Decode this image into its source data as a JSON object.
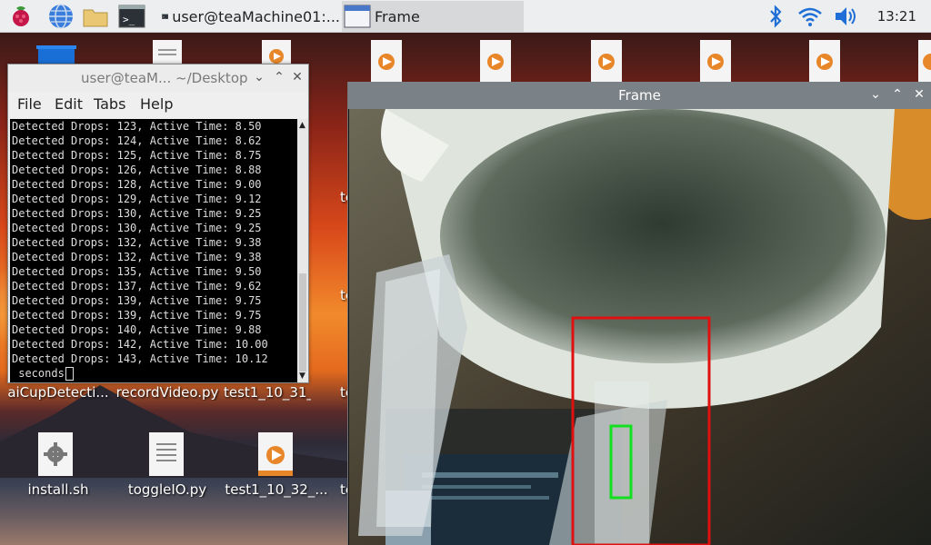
{
  "taskbar": {
    "tasks": [
      {
        "label": "user@teaMachine01:..."
      },
      {
        "label": "Frame"
      }
    ],
    "clock": "13:21"
  },
  "desktop": {
    "icons": [
      {
        "label": "aiCupDetecti..."
      },
      {
        "label": "recordVideo.py"
      },
      {
        "label": "test1_10_31_..."
      },
      {
        "label": "install.sh"
      },
      {
        "label": "toggleIO.py"
      },
      {
        "label": "test1_10_32_..."
      }
    ],
    "partial_labels": [
      "te",
      "te",
      "te",
      "te",
      "te",
      "te"
    ]
  },
  "terminal": {
    "title": "user@teaM... ~/Desktop",
    "menu": [
      "File",
      "Edit",
      "Tabs",
      "Help"
    ],
    "lines": [
      "Detected Drops: 123, Active Time: 8.50",
      "Detected Drops: 124, Active Time: 8.62",
      "Detected Drops: 125, Active Time: 8.75",
      "Detected Drops: 126, Active Time: 8.88",
      "Detected Drops: 128, Active Time: 9.00",
      "Detected Drops: 129, Active Time: 9.12",
      "Detected Drops: 130, Active Time: 9.25",
      "Detected Drops: 130, Active Time: 9.25",
      "Detected Drops: 132, Active Time: 9.38",
      "Detected Drops: 132, Active Time: 9.38",
      "Detected Drops: 135, Active Time: 9.50",
      "Detected Drops: 137, Active Time: 9.62",
      "Detected Drops: 139, Active Time: 9.75",
      "Detected Drops: 139, Active Time: 9.75",
      "Detected Drops: 140, Active Time: 9.88",
      "Detected Drops: 142, Active Time: 10.00",
      "Detected Drops: 143, Active Time: 10.12",
      " seconds"
    ]
  },
  "frame_window": {
    "title": "Frame"
  },
  "colors": {
    "detection_box": "#e01010",
    "drop_box": "#10e020"
  }
}
